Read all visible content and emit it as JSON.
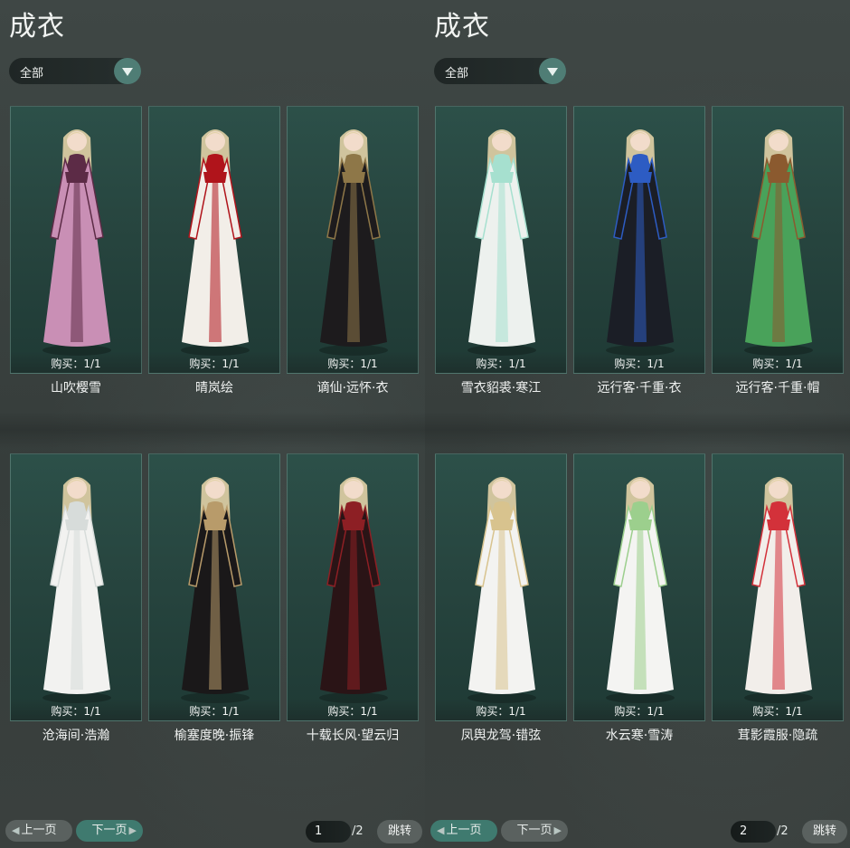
{
  "left": {
    "title": "成衣",
    "filter": {
      "selected": "全部",
      "icon": "chevron-down-icon"
    },
    "items": [
      {
        "name": "山吹樱雪",
        "purchase": "购买：1/1",
        "colors": {
          "robe": "#c98fb5",
          "trim": "#5c2b46",
          "hair": "#e2d2a6"
        }
      },
      {
        "name": "晴岚绘",
        "purchase": "购买：1/1",
        "colors": {
          "robe": "#f2eee8",
          "trim": "#b0141b",
          "hair": "#e2d2a6"
        }
      },
      {
        "name": "谪仙·远怀·衣",
        "purchase": "购买：1/1",
        "colors": {
          "robe": "#1d1b1d",
          "trim": "#8e7748",
          "hair": "#e2d2a6"
        }
      },
      {
        "name": "沧海间·浩瀚",
        "purchase": "购买：1/1",
        "colors": {
          "robe": "#f2f2f0",
          "trim": "#d7dcda",
          "hair": "#e2d2a6"
        }
      },
      {
        "name": "榆塞度晚·振锋",
        "purchase": "购买：1/1",
        "colors": {
          "robe": "#1a1819",
          "trim": "#b89b6a",
          "hair": "#e2d2a6"
        }
      },
      {
        "name": "十载长风·望云归",
        "purchase": "购买：1/1",
        "colors": {
          "robe": "#2a1416",
          "trim": "#8d1f24",
          "hair": "#e2d2a6"
        }
      }
    ],
    "pager": {
      "prev": "上一页",
      "next": "下一页",
      "page": "1",
      "total": "/2",
      "jump": "跳转"
    }
  },
  "right": {
    "title": "成衣",
    "filter": {
      "selected": "全部",
      "icon": "chevron-down-icon"
    },
    "items": [
      {
        "name": "雪衣貂裘·寒江",
        "purchase": "购买：1/1",
        "colors": {
          "robe": "#edf1ee",
          "trim": "#a6e0cf",
          "hair": "#e2d2a6"
        }
      },
      {
        "name": "远行客·千重·衣",
        "purchase": "购买：1/1",
        "colors": {
          "robe": "#1b1e26",
          "trim": "#2d5cc3",
          "hair": "#e2d2a6"
        }
      },
      {
        "name": "远行客·千重·帽",
        "purchase": "购买：1/1",
        "colors": {
          "robe": "#49a25a",
          "trim": "#8b5a2f",
          "hair": "#e2d2a6"
        }
      },
      {
        "name": "凤舆龙驾·错弦",
        "purchase": "购买：1/1",
        "colors": {
          "robe": "#f3f3f1",
          "trim": "#d8c38e",
          "hair": "#e2d2a6"
        }
      },
      {
        "name": "水云寒·雪涛",
        "purchase": "购买：1/1",
        "colors": {
          "robe": "#f4f4f2",
          "trim": "#9ccf8d",
          "hair": "#e2d2a6"
        }
      },
      {
        "name": "茸影霞服·隐疏",
        "purchase": "购买：1/1",
        "colors": {
          "robe": "#f2eeea",
          "trim": "#d3313a",
          "hair": "#e2d2a6"
        }
      }
    ],
    "pager": {
      "prev": "上一页",
      "next": "下一页",
      "page": "2",
      "total": "/2",
      "jump": "跳转"
    }
  }
}
